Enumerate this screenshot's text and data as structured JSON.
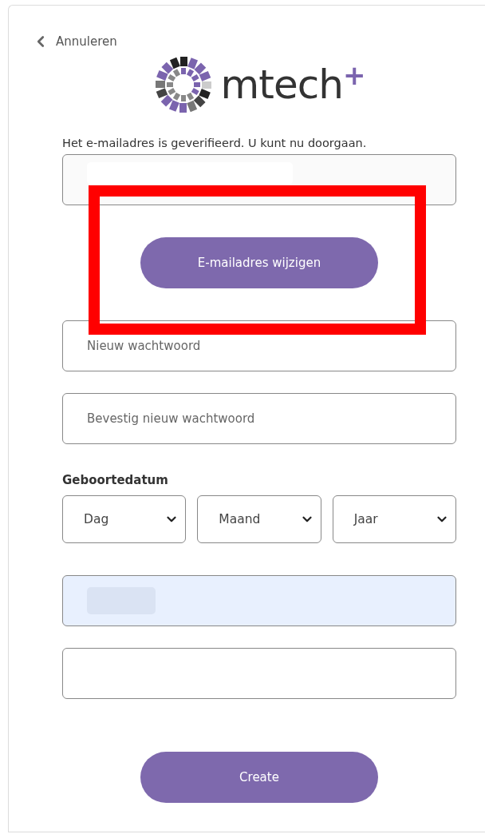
{
  "cancel_link": {
    "label": "Annuleren"
  },
  "logo": {
    "wordmark": "mtech",
    "mark": "+"
  },
  "verified_message": "Het e-mailadres is geverifieerd. U kunt nu doorgaan.",
  "change_email_button": {
    "label": "E-mailadres wijzigen",
    "highlighted": true
  },
  "password_fields": [
    {
      "placeholder": "Nieuw wachtwoord"
    },
    {
      "placeholder": "Bevestig nieuw wachtwoord"
    }
  ],
  "birthdate": {
    "label": "Geboortedatum",
    "selects": [
      {
        "value": "Dag"
      },
      {
        "value": "Maand"
      },
      {
        "value": "Jaar"
      }
    ]
  },
  "extra_fields": [
    {
      "kind": "autofilled"
    },
    {
      "kind": "text"
    }
  ],
  "create_button": {
    "label": "Create"
  }
}
